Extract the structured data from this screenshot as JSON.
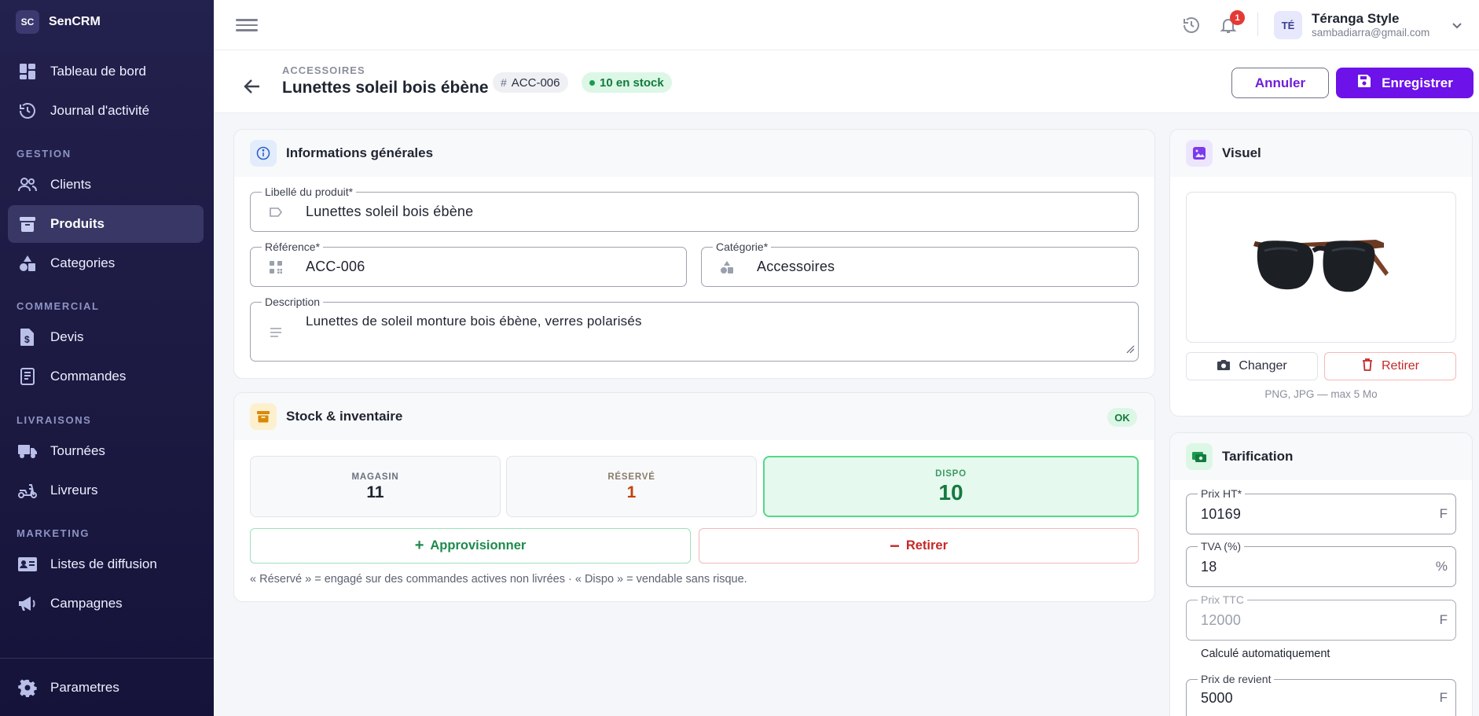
{
  "brand": {
    "badge": "SC",
    "name": "SenCRM"
  },
  "sidebar": {
    "items": [
      {
        "label": "Tableau de bord",
        "icon": "dashboard-icon"
      },
      {
        "label": "Journal d'activité",
        "icon": "history-icon"
      },
      {
        "label": "Clients",
        "icon": "users-icon"
      },
      {
        "label": "Produits",
        "icon": "archive-box-icon",
        "active": true
      },
      {
        "label": "Categories",
        "icon": "shapes-icon"
      },
      {
        "label": "Devis",
        "icon": "invoice-icon"
      },
      {
        "label": "Commandes",
        "icon": "orders-icon"
      },
      {
        "label": "Tournées",
        "icon": "truck-icon"
      },
      {
        "label": "Livreurs",
        "icon": "scooter-icon"
      },
      {
        "label": "Listes de diffusion",
        "icon": "contact-card-icon"
      },
      {
        "label": "Campagnes",
        "icon": "megaphone-icon"
      },
      {
        "label": "Parametres",
        "icon": "gear-icon"
      }
    ],
    "sections": [
      "GESTION",
      "COMMERCIAL",
      "LIVRAISONS",
      "MARKETING"
    ]
  },
  "topbar": {
    "notifications_count": "1",
    "user_initials": "TÉ",
    "user_name": "Téranga Style",
    "user_email": "sambadiarra@gmail.com"
  },
  "page": {
    "breadcrumb": "ACCESSOIRES",
    "title": "Lunettes soleil bois ébène",
    "ref_chip": "ACC-006",
    "stock_chip": "10 en stock",
    "cancel_label": "Annuler",
    "save_label": "Enregistrer"
  },
  "general": {
    "title": "Informations générales",
    "name_label": "Libellé du produit*",
    "name_value": "Lunettes soleil bois ébène",
    "ref_label": "Référence*",
    "ref_value": "ACC-006",
    "category_label": "Catégorie*",
    "category_value": "Accessoires",
    "desc_label": "Description",
    "desc_value": "Lunettes de soleil monture bois ébène, verres polarisés"
  },
  "stock": {
    "title": "Stock & inventaire",
    "status": "OK",
    "magasin_label": "MAGASIN",
    "magasin_value": "11",
    "reserve_label": "RÉSERVÉ",
    "reserve_value": "1",
    "dispo_label": "DISPO",
    "dispo_value": "10",
    "supply_label": "Approvisionner",
    "remove_label": "Retirer",
    "note": "« Réservé » = engagé sur des commandes actives non livrées · « Dispo » = vendable sans risque."
  },
  "visual": {
    "title": "Visuel",
    "change_label": "Changer",
    "remove_label": "Retirer",
    "formats": "PNG, JPG — max 5 Mo"
  },
  "pricing": {
    "title": "Tarification",
    "ht_label": "Prix HT*",
    "ht_value": "10169",
    "ht_unit": "F",
    "tva_label": "TVA (%)",
    "tva_value": "18",
    "tva_unit": "%",
    "ttc_label": "Prix TTC",
    "ttc_value": "12000",
    "ttc_unit": "F",
    "calc_note": "Calculé automatiquement",
    "cost_label": "Prix de revient",
    "cost_value": "5000",
    "cost_unit": "F"
  },
  "colors": {
    "accent": "#6d12e8",
    "sidebar": "#1f1d46",
    "success": "#1c9a4f",
    "danger": "#d32f2f",
    "reserved": "#c2410c"
  }
}
